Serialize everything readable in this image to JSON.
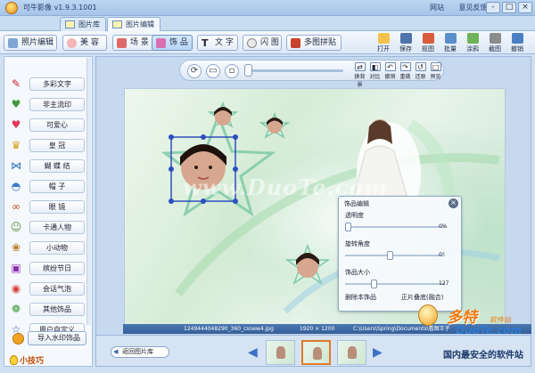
{
  "window": {
    "title": "可牛影像  v1.9.3.1001",
    "links": [
      "网站",
      "意见反馈"
    ],
    "controls": [
      "-",
      "□",
      "×"
    ]
  },
  "tabs": [
    {
      "label": "图片库",
      "active": false
    },
    {
      "label": "图片编辑",
      "active": true
    }
  ],
  "toolbar": {
    "left": [
      {
        "label": "照片编辑",
        "active": false
      },
      {
        "label": "美 容",
        "active": false
      },
      {
        "label": "场 景",
        "active": false
      },
      {
        "label": "饰 品",
        "active": true
      },
      {
        "label": "文 字",
        "active": false
      },
      {
        "label": "闪 图",
        "active": false
      },
      {
        "label": "多图拼贴",
        "active": false
      }
    ],
    "right": [
      "打开",
      "保存",
      "抠图",
      "批量",
      "涂鸦",
      "截图",
      "撤销"
    ]
  },
  "sidebar": {
    "items": [
      {
        "label": "多彩文字",
        "icon": "text-icon"
      },
      {
        "label": "非主流印",
        "icon": "heart-stamp-icon"
      },
      {
        "label": "可爱心",
        "icon": "heart-icon"
      },
      {
        "label": "皇 冠",
        "icon": "crown-icon"
      },
      {
        "label": "蝴 蝶 结",
        "icon": "bow-icon"
      },
      {
        "label": "帽 子",
        "icon": "hat-icon"
      },
      {
        "label": "眼 镜",
        "icon": "glasses-icon"
      },
      {
        "label": "卡通人物",
        "icon": "cartoon-icon"
      },
      {
        "label": "小动物",
        "icon": "animal-icon"
      },
      {
        "label": "缤纷节日",
        "icon": "gift-icon"
      },
      {
        "label": "会话气泡",
        "icon": "bubble-icon"
      },
      {
        "label": "其他饰品",
        "icon": "ornament-icon"
      },
      {
        "label": "用户自定义",
        "icon": "star-icon"
      }
    ],
    "import_label": "导入水印饰品",
    "tips_label": "小技巧"
  },
  "viewbar": {
    "buttons": [
      "换背景",
      "对比",
      "撤销",
      "重做",
      "还原",
      "预览"
    ]
  },
  "canvas": {
    "watermark": "www.DuoTe.com"
  },
  "editor_panel": {
    "title": "饰品编辑",
    "opacity_label": "透明度",
    "opacity_value": "0%",
    "opacity_level": 0,
    "rotate_label": "旋转角度",
    "rotate_value": "0°",
    "rotate_level": 0.45,
    "size_label": "饰品大小",
    "size_value": "127",
    "size_level": 0.28,
    "delete_label": "删除本饰品",
    "blend_label": "正片叠底(融合)"
  },
  "statusbar": {
    "filename": "1249444048290_360_csnew4.jpg",
    "dimensions": "1920 × 1200",
    "path": "C:\\Users\\Spring\\Documents\\看图王子"
  },
  "filmstrip": {
    "back_label": "返回图片库",
    "prev": "◀",
    "next": "▶"
  },
  "site_badge": {
    "brand": "多特",
    "brand_sub": "软件站",
    "domain": "DuoTe.com",
    "slogan": "国内最安全的软件站"
  },
  "colors": {
    "accent": "#3b73c5",
    "selection": "#2d4fbf",
    "brand_orange": "#f07a0e"
  }
}
